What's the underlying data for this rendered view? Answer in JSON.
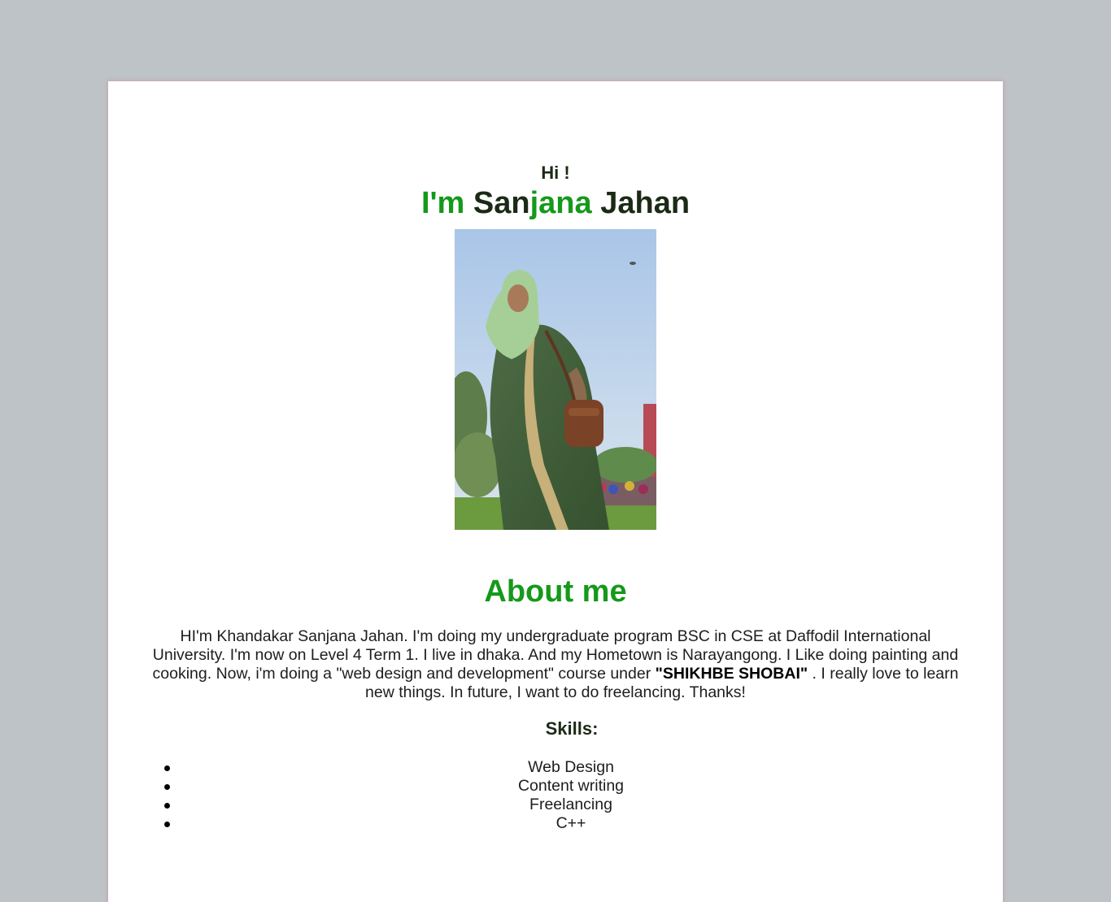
{
  "header": {
    "greeting": "Hi !",
    "name_part1": "I'm",
    "name_part2": "San",
    "name_part3": "jana",
    "name_part4": "Jahan"
  },
  "about": {
    "title": "About me",
    "text_before": "HI'm Khandakar Sanjana Jahan. I'm doing my undergraduate program BSC in CSE at Daffodil International University. I'm now on Level 4 Term 1. I live in dhaka. And my Hometown is Narayangong. I Like doing painting and cooking. Now, i'm doing a \"web design and development\" course under ",
    "text_bold": "\"SHIKHBE SHOBAI\"",
    "text_after": " . I really love to learn new things. In future, I want to do freelancing. Thanks!"
  },
  "skills": {
    "title": "Skills:",
    "items": [
      "Web Design",
      "Content writing",
      "Freelancing",
      "C++"
    ]
  },
  "colors": {
    "accent_green": "#15991a",
    "dark_text": "#1b2a16",
    "page_bg": "#bec3c7"
  }
}
